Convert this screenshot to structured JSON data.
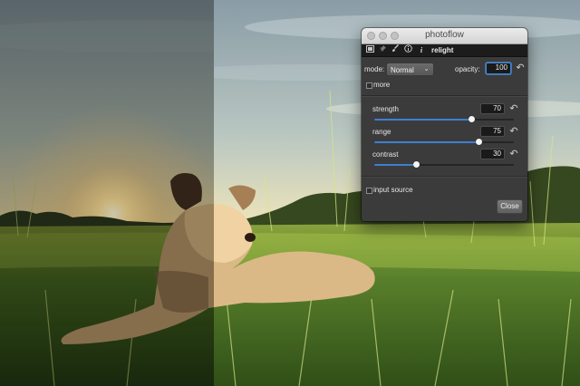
{
  "window": {
    "title": "photoflow"
  },
  "toolbar": {
    "icons": [
      "image-icon",
      "pin-icon",
      "brush-icon",
      "info-circle-icon",
      "info-icon"
    ],
    "layer_name": "relight"
  },
  "blend": {
    "mode_label": "mode:",
    "mode_value": "Normal",
    "opacity_label": "opacity:",
    "opacity_value": "100"
  },
  "more_label": "more",
  "sliders": [
    {
      "label": "strength",
      "value": "70",
      "min": 0,
      "max": 100
    },
    {
      "label": "range",
      "value": "75",
      "min": 0,
      "max": 100
    },
    {
      "label": "contrast",
      "value": "30",
      "min": 0,
      "max": 100
    }
  ],
  "input_source_label": "input source",
  "close_label": "Close",
  "colors": {
    "accent": "#3f7fd0",
    "panel": "#3b3b3b",
    "toolbar": "#1c1c1c"
  }
}
